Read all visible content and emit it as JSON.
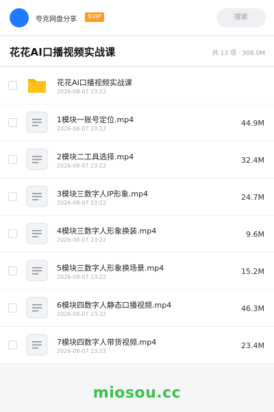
{
  "header": {
    "owner_name": "夸克网盘分享",
    "badge": "SVIP",
    "search_label": "搜索"
  },
  "folder": {
    "title": "花花AI口播视频实战课",
    "summary": "共 13 项 · 308.0M"
  },
  "files": [
    {
      "type": "folder",
      "name": "花花AI口播视频实战课",
      "date": "2026-08-07 23:22",
      "size": ""
    },
    {
      "type": "file",
      "name": "1模块一账号定位.mp4",
      "date": "2026-08-07 23:22",
      "size": "44.9M"
    },
    {
      "type": "file",
      "name": "2模块二工具选择.mp4",
      "date": "2026-08-07 23:22",
      "size": "32.4M"
    },
    {
      "type": "file",
      "name": "3模块三数字人IP形象.mp4",
      "date": "2026-08-07 23:22",
      "size": "24.7M"
    },
    {
      "type": "file",
      "name": "4模块三数字人形象换装.mp4",
      "date": "2026-08-07 23:22",
      "size": "9.6M"
    },
    {
      "type": "file",
      "name": "5模块三数字人形象换场景.mp4",
      "date": "2026-08-07 23:22",
      "size": "15.2M"
    },
    {
      "type": "file",
      "name": "6模块四数字人静态口播视频.mp4",
      "date": "2026-08-07 23:22",
      "size": "46.3M"
    },
    {
      "type": "file",
      "name": "7模块四数字人带货视频.mp4",
      "date": "2026-08-07 23:22",
      "size": "23.4M"
    }
  ],
  "colors": {
    "accent_blue": "#1f7bff",
    "svip_orange": "#ff9a1f",
    "folder_yellow": "#ffc21a",
    "brand_green": "#3cc24c"
  },
  "icons": {
    "folder": "folder-icon",
    "file": "document-icon"
  },
  "watermark": "miosou.cc"
}
